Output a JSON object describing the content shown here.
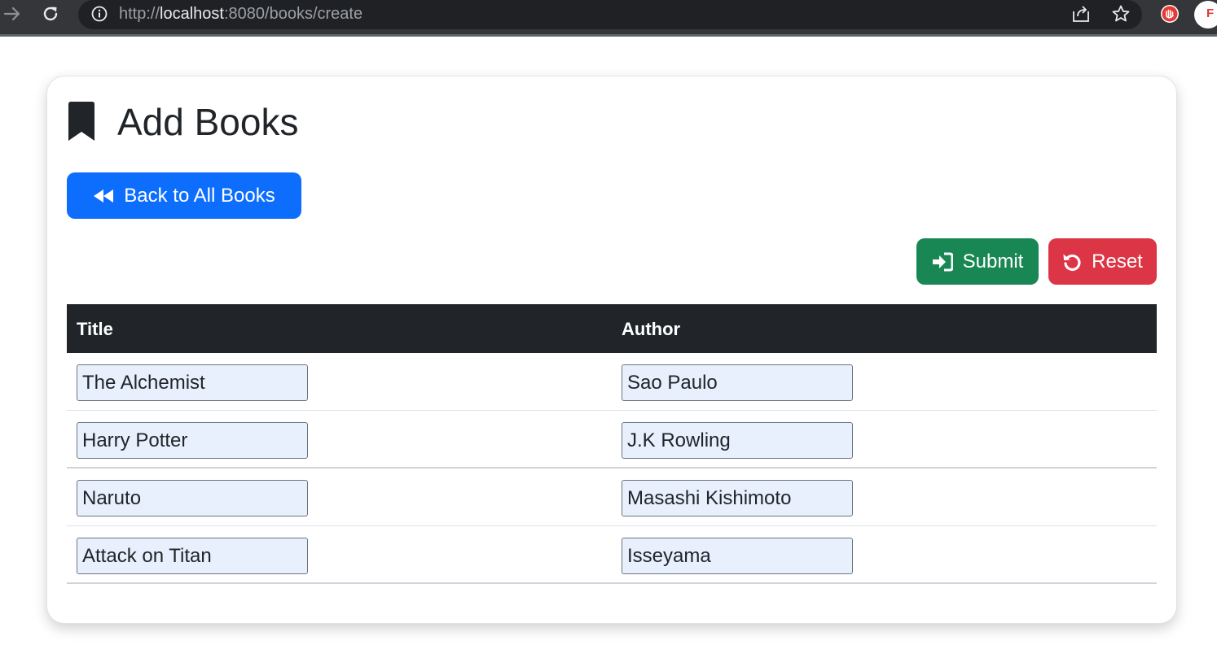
{
  "browser": {
    "url_scheme": "http://",
    "url_host": "localhost",
    "url_path": ":8080/books/create"
  },
  "page": {
    "title": "Add Books",
    "back_button": "Back to All Books",
    "submit_button": "Submit",
    "reset_button": "Reset"
  },
  "table": {
    "headers": [
      "Title",
      "Author"
    ],
    "rows": [
      {
        "title": "The Alchemist",
        "author": "Sao Paulo"
      },
      {
        "title": "Harry Potter",
        "author": "J.K Rowling"
      },
      {
        "title": "Naruto",
        "author": "Masashi Kishimoto"
      },
      {
        "title": "Attack on Titan",
        "author": "Isseyama"
      }
    ]
  },
  "colors": {
    "primary": "#0d6efd",
    "success": "#198754",
    "danger": "#dc3545",
    "table_header": "#212529",
    "input_fill": "#e8f0fe"
  },
  "icons": [
    "forward-arrow-icon",
    "reload-icon",
    "info-icon",
    "share-icon",
    "star-icon",
    "extension-icon",
    "bookmark-icon",
    "backward-icon",
    "sign-in-icon",
    "undo-icon"
  ]
}
